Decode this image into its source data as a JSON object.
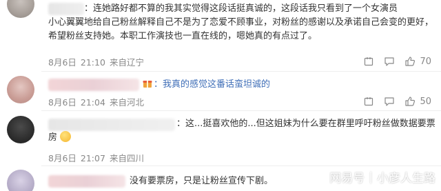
{
  "comments": [
    {
      "text_line1": "：连她路好都不算的我其实觉得这段话挺真诚的，这段话我只看到了一个女演员",
      "text_line2": "小心翼翼地给自己粉丝解释自己不是为了恋爱不顾事业，对粉丝的感谢以及承诺自己会变的更好，",
      "text_line3": "希望粉丝支持她。本职工作演技也一直在线的，嗯她真的有点过了。",
      "date": "8月6日",
      "time": "21:10",
      "source": "来自辽宁",
      "likes": "70"
    },
    {
      "text": "：我真的感觉这番话蛮坦诚的",
      "date": "8月6日",
      "time": "21:04",
      "source": "来自河北",
      "likes": "50"
    },
    {
      "text_line1": "：这...挺喜欢他的...但这姐妹为什么要在群里呼吁粉丝做数据要票",
      "text_line2": "房",
      "date": "8月6日",
      "time": "21:07",
      "source": "来自四川"
    },
    {
      "text": "没有要票房，只是让粉丝宣传下剧。"
    }
  ],
  "watermark": {
    "brand": "网易号",
    "separator": "|",
    "account": "小彦人生路"
  },
  "colors": {
    "link_blue": "#3f6eb7",
    "meta_gray": "#888888",
    "text": "#333333"
  }
}
